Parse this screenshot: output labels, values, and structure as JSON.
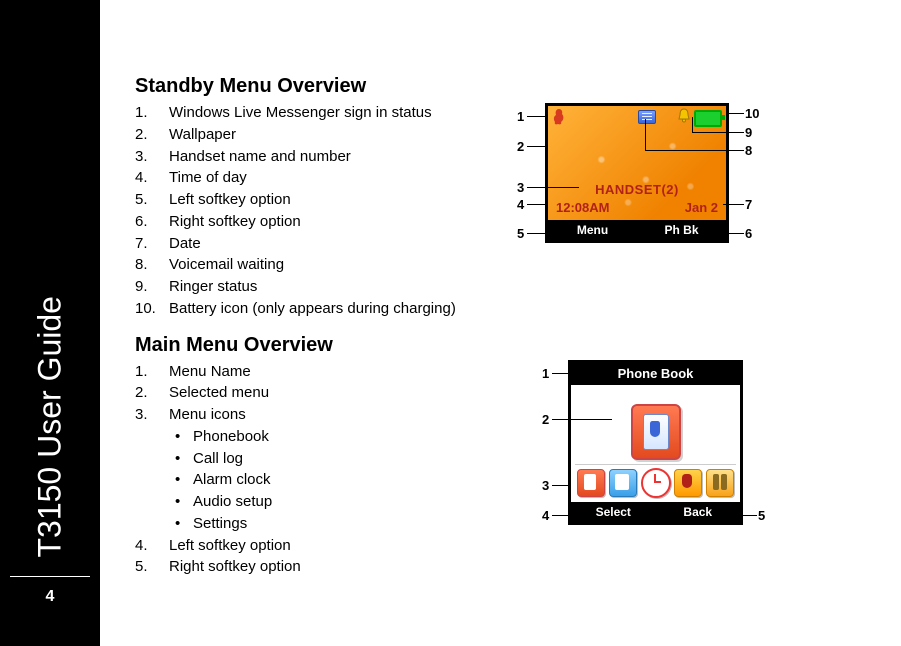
{
  "sidebar": {
    "title": "T3150 User Guide",
    "page_number": "4"
  },
  "section1": {
    "heading": "Standby Menu Overview",
    "items": [
      "Windows Live Messenger sign in status",
      "Wallpaper",
      "Handset name and number",
      "Time of day",
      "Left softkey option",
      "Right softkey option",
      "Date",
      "Voicemail waiting",
      "Ringer status",
      "Battery icon (only appears during charging)"
    ]
  },
  "section2": {
    "heading": "Main Menu Overview",
    "items": [
      "Menu Name",
      "Selected menu",
      "Menu icons",
      "Left softkey option",
      "Right softkey option"
    ],
    "subicons": [
      "Phonebook",
      "Call log",
      "Alarm clock",
      "Audio setup",
      "Settings"
    ]
  },
  "standby_screen": {
    "handset_label": "HANDSET(2)",
    "time": "12:08AM",
    "date": "Jan 2",
    "soft_left": "Menu",
    "soft_right": "Ph Bk"
  },
  "main_menu_screen": {
    "title": "Phone Book",
    "soft_left": "Select",
    "soft_right": "Back"
  },
  "callouts_fig1": {
    "c1": "1",
    "c2": "2",
    "c3": "3",
    "c4": "4",
    "c5": "5",
    "c6": "6",
    "c7": "7",
    "c8": "8",
    "c9": "9",
    "c10": "10"
  },
  "callouts_fig2": {
    "c1": "1",
    "c2": "2",
    "c3": "3",
    "c4": "4",
    "c5": "5"
  }
}
